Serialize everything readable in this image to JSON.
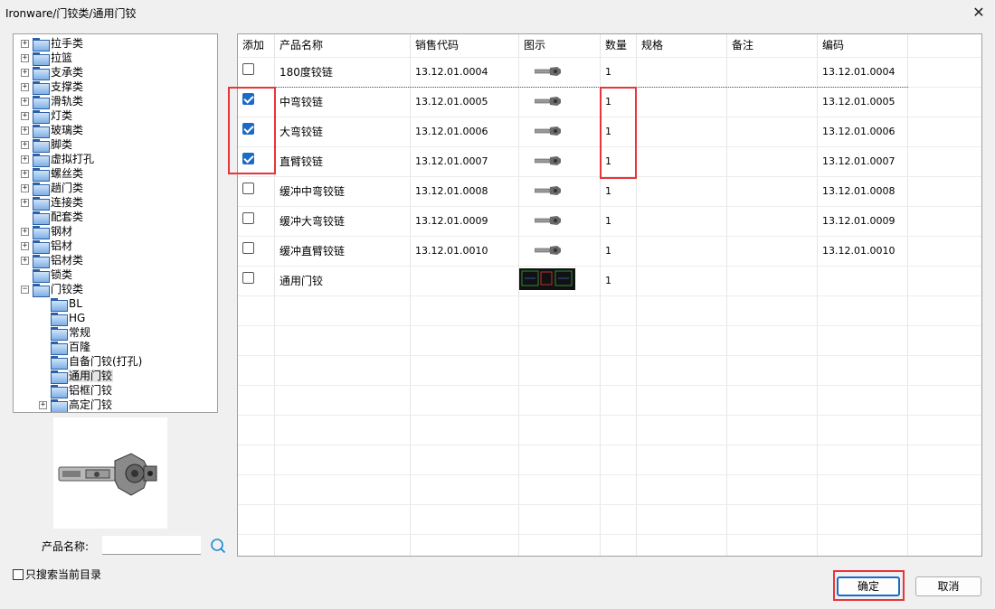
{
  "window": {
    "title": "Ironware/门铰类/通用门铰",
    "close_label": "✕"
  },
  "tree": {
    "items": [
      {
        "label": "拉手类",
        "level": 0,
        "expander": "+"
      },
      {
        "label": "拉篮",
        "level": 0,
        "expander": "+"
      },
      {
        "label": "支承类",
        "level": 0,
        "expander": "+"
      },
      {
        "label": "支撑类",
        "level": 0,
        "expander": "+"
      },
      {
        "label": "滑轨类",
        "level": 0,
        "expander": "+"
      },
      {
        "label": "灯类",
        "level": 0,
        "expander": "+"
      },
      {
        "label": "玻璃类",
        "level": 0,
        "expander": "+"
      },
      {
        "label": "脚类",
        "level": 0,
        "expander": "+"
      },
      {
        "label": "虚拟打孔",
        "level": 0,
        "expander": "+"
      },
      {
        "label": "螺丝类",
        "level": 0,
        "expander": "+"
      },
      {
        "label": "趟门类",
        "level": 0,
        "expander": "+"
      },
      {
        "label": "连接类",
        "level": 0,
        "expander": "+"
      },
      {
        "label": "配套类",
        "level": 0,
        "expander": ""
      },
      {
        "label": "钢材",
        "level": 0,
        "expander": "+"
      },
      {
        "label": "铝材",
        "level": 0,
        "expander": "+"
      },
      {
        "label": "铝材类",
        "level": 0,
        "expander": "+"
      },
      {
        "label": "锁类",
        "level": 0,
        "expander": ""
      },
      {
        "label": "门铰类",
        "level": 0,
        "expander": "−"
      },
      {
        "label": "BL",
        "level": 1,
        "expander": ""
      },
      {
        "label": "HG",
        "level": 1,
        "expander": ""
      },
      {
        "label": "常规",
        "level": 1,
        "expander": ""
      },
      {
        "label": "百隆",
        "level": 1,
        "expander": ""
      },
      {
        "label": "自备门铰(打孔)",
        "level": 1,
        "expander": ""
      },
      {
        "label": "通用门铰",
        "level": 1,
        "expander": "",
        "selected": true
      },
      {
        "label": "铝框门铰",
        "level": 1,
        "expander": ""
      },
      {
        "label": "高定门铰",
        "level": 1,
        "expander": "+"
      }
    ]
  },
  "search": {
    "label": "产品名称:",
    "value": "",
    "placeholder": "",
    "only_current_dir": "只搜索当前目录"
  },
  "table": {
    "headers": [
      "添加",
      "产品名称",
      "销售代码",
      "图示",
      "数量",
      "规格",
      "备注",
      "编码"
    ],
    "rows": [
      {
        "checked": false,
        "name": "180度铰链",
        "code": "13.12.01.0004",
        "image": "hinge",
        "qty": "1",
        "spec": "",
        "note": "",
        "id": "13.12.01.0004"
      },
      {
        "checked": true,
        "name": "中弯铰链",
        "code": "13.12.01.0005",
        "image": "hinge",
        "qty": "1",
        "spec": "",
        "note": "",
        "id": "13.12.01.0005"
      },
      {
        "checked": true,
        "name": "大弯铰链",
        "code": "13.12.01.0006",
        "image": "hinge",
        "qty": "1",
        "spec": "",
        "note": "",
        "id": "13.12.01.0006"
      },
      {
        "checked": true,
        "name": "直臂铰链",
        "code": "13.12.01.0007",
        "image": "hinge",
        "qty": "1",
        "spec": "",
        "note": "",
        "id": "13.12.01.0007"
      },
      {
        "checked": false,
        "name": "缓冲中弯铰链",
        "code": "13.12.01.0008",
        "image": "hinge",
        "qty": "1",
        "spec": "",
        "note": "",
        "id": "13.12.01.0008"
      },
      {
        "checked": false,
        "name": "缓冲大弯铰链",
        "code": "13.12.01.0009",
        "image": "hinge",
        "qty": "1",
        "spec": "",
        "note": "",
        "id": "13.12.01.0009"
      },
      {
        "checked": false,
        "name": "缓冲直臂铰链",
        "code": "13.12.01.0010",
        "image": "hinge",
        "qty": "1",
        "spec": "",
        "note": "",
        "id": "13.12.01.0010"
      },
      {
        "checked": false,
        "name": "通用门铰",
        "code": "",
        "image": "cad-drawing",
        "qty": "1",
        "spec": "",
        "note": "",
        "id": ""
      }
    ]
  },
  "buttons": {
    "ok": "确定",
    "cancel": "取消"
  },
  "colors": {
    "highlight_box": "#e8353b",
    "checkbox_checked": "#1a6bc7"
  }
}
